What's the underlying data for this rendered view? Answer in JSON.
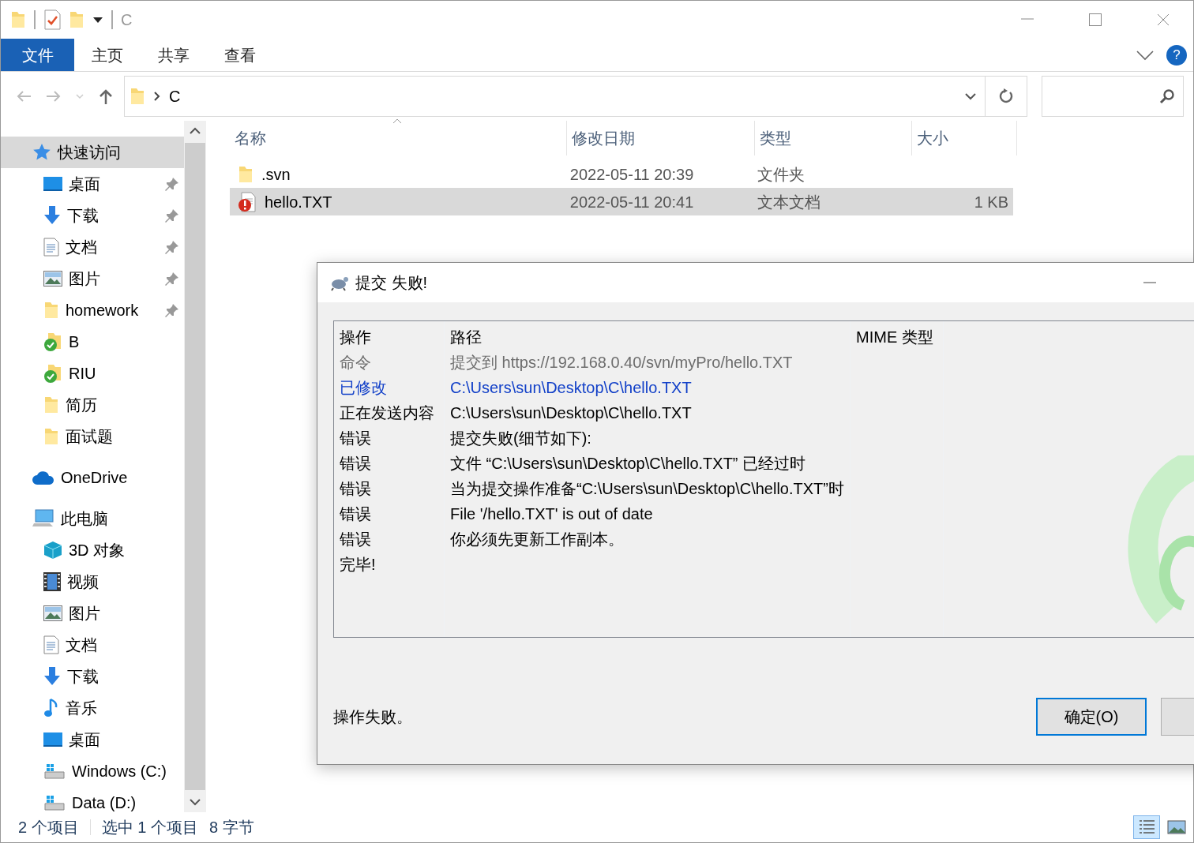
{
  "window": {
    "title": "C"
  },
  "ribbon": {
    "tabs": [
      {
        "label": "文件",
        "selected": true
      },
      {
        "label": "主页",
        "selected": false
      },
      {
        "label": "共享",
        "selected": false
      },
      {
        "label": "查看",
        "selected": false
      }
    ],
    "help": "?"
  },
  "address_bar": {
    "path": [
      "C"
    ]
  },
  "navigation": [
    {
      "label": "快速访问",
      "kind": "star",
      "selected": true,
      "children": [
        {
          "label": "桌面",
          "kind": "desktop",
          "pinned": true
        },
        {
          "label": "下载",
          "kind": "download",
          "pinned": true
        },
        {
          "label": "文档",
          "kind": "document",
          "pinned": true
        },
        {
          "label": "图片",
          "kind": "picture",
          "pinned": true
        },
        {
          "label": "homework",
          "kind": "folder",
          "pinned": true
        },
        {
          "label": "B",
          "kind": "folder-ok",
          "pinned": false
        },
        {
          "label": "RIU",
          "kind": "folder-ok",
          "pinned": false
        },
        {
          "label": "简历",
          "kind": "folder",
          "pinned": false
        },
        {
          "label": "面试题",
          "kind": "folder",
          "pinned": false
        }
      ]
    },
    {
      "label": "OneDrive",
      "kind": "cloud",
      "selected": false
    },
    {
      "label": "此电脑",
      "kind": "computer",
      "selected": false,
      "children": [
        {
          "label": "3D 对象",
          "kind": "cube",
          "pinned": false
        },
        {
          "label": "视频",
          "kind": "video",
          "pinned": false
        },
        {
          "label": "图片",
          "kind": "picture",
          "pinned": false
        },
        {
          "label": "文档",
          "kind": "document",
          "pinned": false
        },
        {
          "label": "下载",
          "kind": "download",
          "pinned": false
        },
        {
          "label": "音乐",
          "kind": "music",
          "pinned": false
        },
        {
          "label": "桌面",
          "kind": "desktop",
          "pinned": false
        },
        {
          "label": "Windows (C:)",
          "kind": "drive",
          "pinned": false
        },
        {
          "label": "Data (D:)",
          "kind": "drive",
          "pinned": false
        }
      ]
    }
  ],
  "file_list": {
    "columns": [
      "名称",
      "修改日期",
      "类型",
      "大小"
    ],
    "rows": [
      {
        "name": ".svn",
        "modified": "2022-05-11 20:39",
        "type": "文件夹",
        "kind": "folder",
        "selected": false
      },
      {
        "name": "hello.TXT",
        "modified": "2022-05-11 20:41",
        "type": "文本文档",
        "size": "1 KB",
        "kind": "conflict",
        "selected": true
      }
    ]
  },
  "status_bar": {
    "item_count": "2 个项目",
    "selection": "选中 1 个项目",
    "selection_size": "8 字节",
    "views": [
      {
        "kind": "details",
        "selected": true
      },
      {
        "kind": "large-icons",
        "selected": false
      }
    ]
  },
  "dialog": {
    "title": "提交 失败!",
    "columns": [
      "操作",
      "路径",
      "MIME 类型"
    ],
    "rows": [
      {
        "kind": "command",
        "action": "命令",
        "path": "提交到 https://192.168.0.40/svn/myPro/hello.TXT"
      },
      {
        "kind": "modified",
        "action": "已修改",
        "path": "C:\\Users\\sun\\Desktop\\C\\hello.TXT"
      },
      {
        "kind": "normal",
        "action": "正在发送内容",
        "path": "C:\\Users\\sun\\Desktop\\C\\hello.TXT"
      },
      {
        "kind": "normal",
        "action": "错误",
        "path": "提交失败(细节如下):"
      },
      {
        "kind": "normal",
        "action": "错误",
        "path": "文件 “C:\\Users\\sun\\Desktop\\C\\hello.TXT” 已经过时"
      },
      {
        "kind": "normal",
        "action": "错误",
        "path": "当为提交操作准备“C:\\Users\\sun\\Desktop\\C\\hello.TXT”时"
      },
      {
        "kind": "normal",
        "action": "错误",
        "path": "File '/hello.TXT' is out of date"
      },
      {
        "kind": "normal",
        "action": "错误",
        "path": "你必须先更新工作副本。"
      },
      {
        "kind": "normal",
        "action": "完毕!"
      }
    ],
    "message": "操作失败。",
    "ok_button": "确定(O)"
  }
}
